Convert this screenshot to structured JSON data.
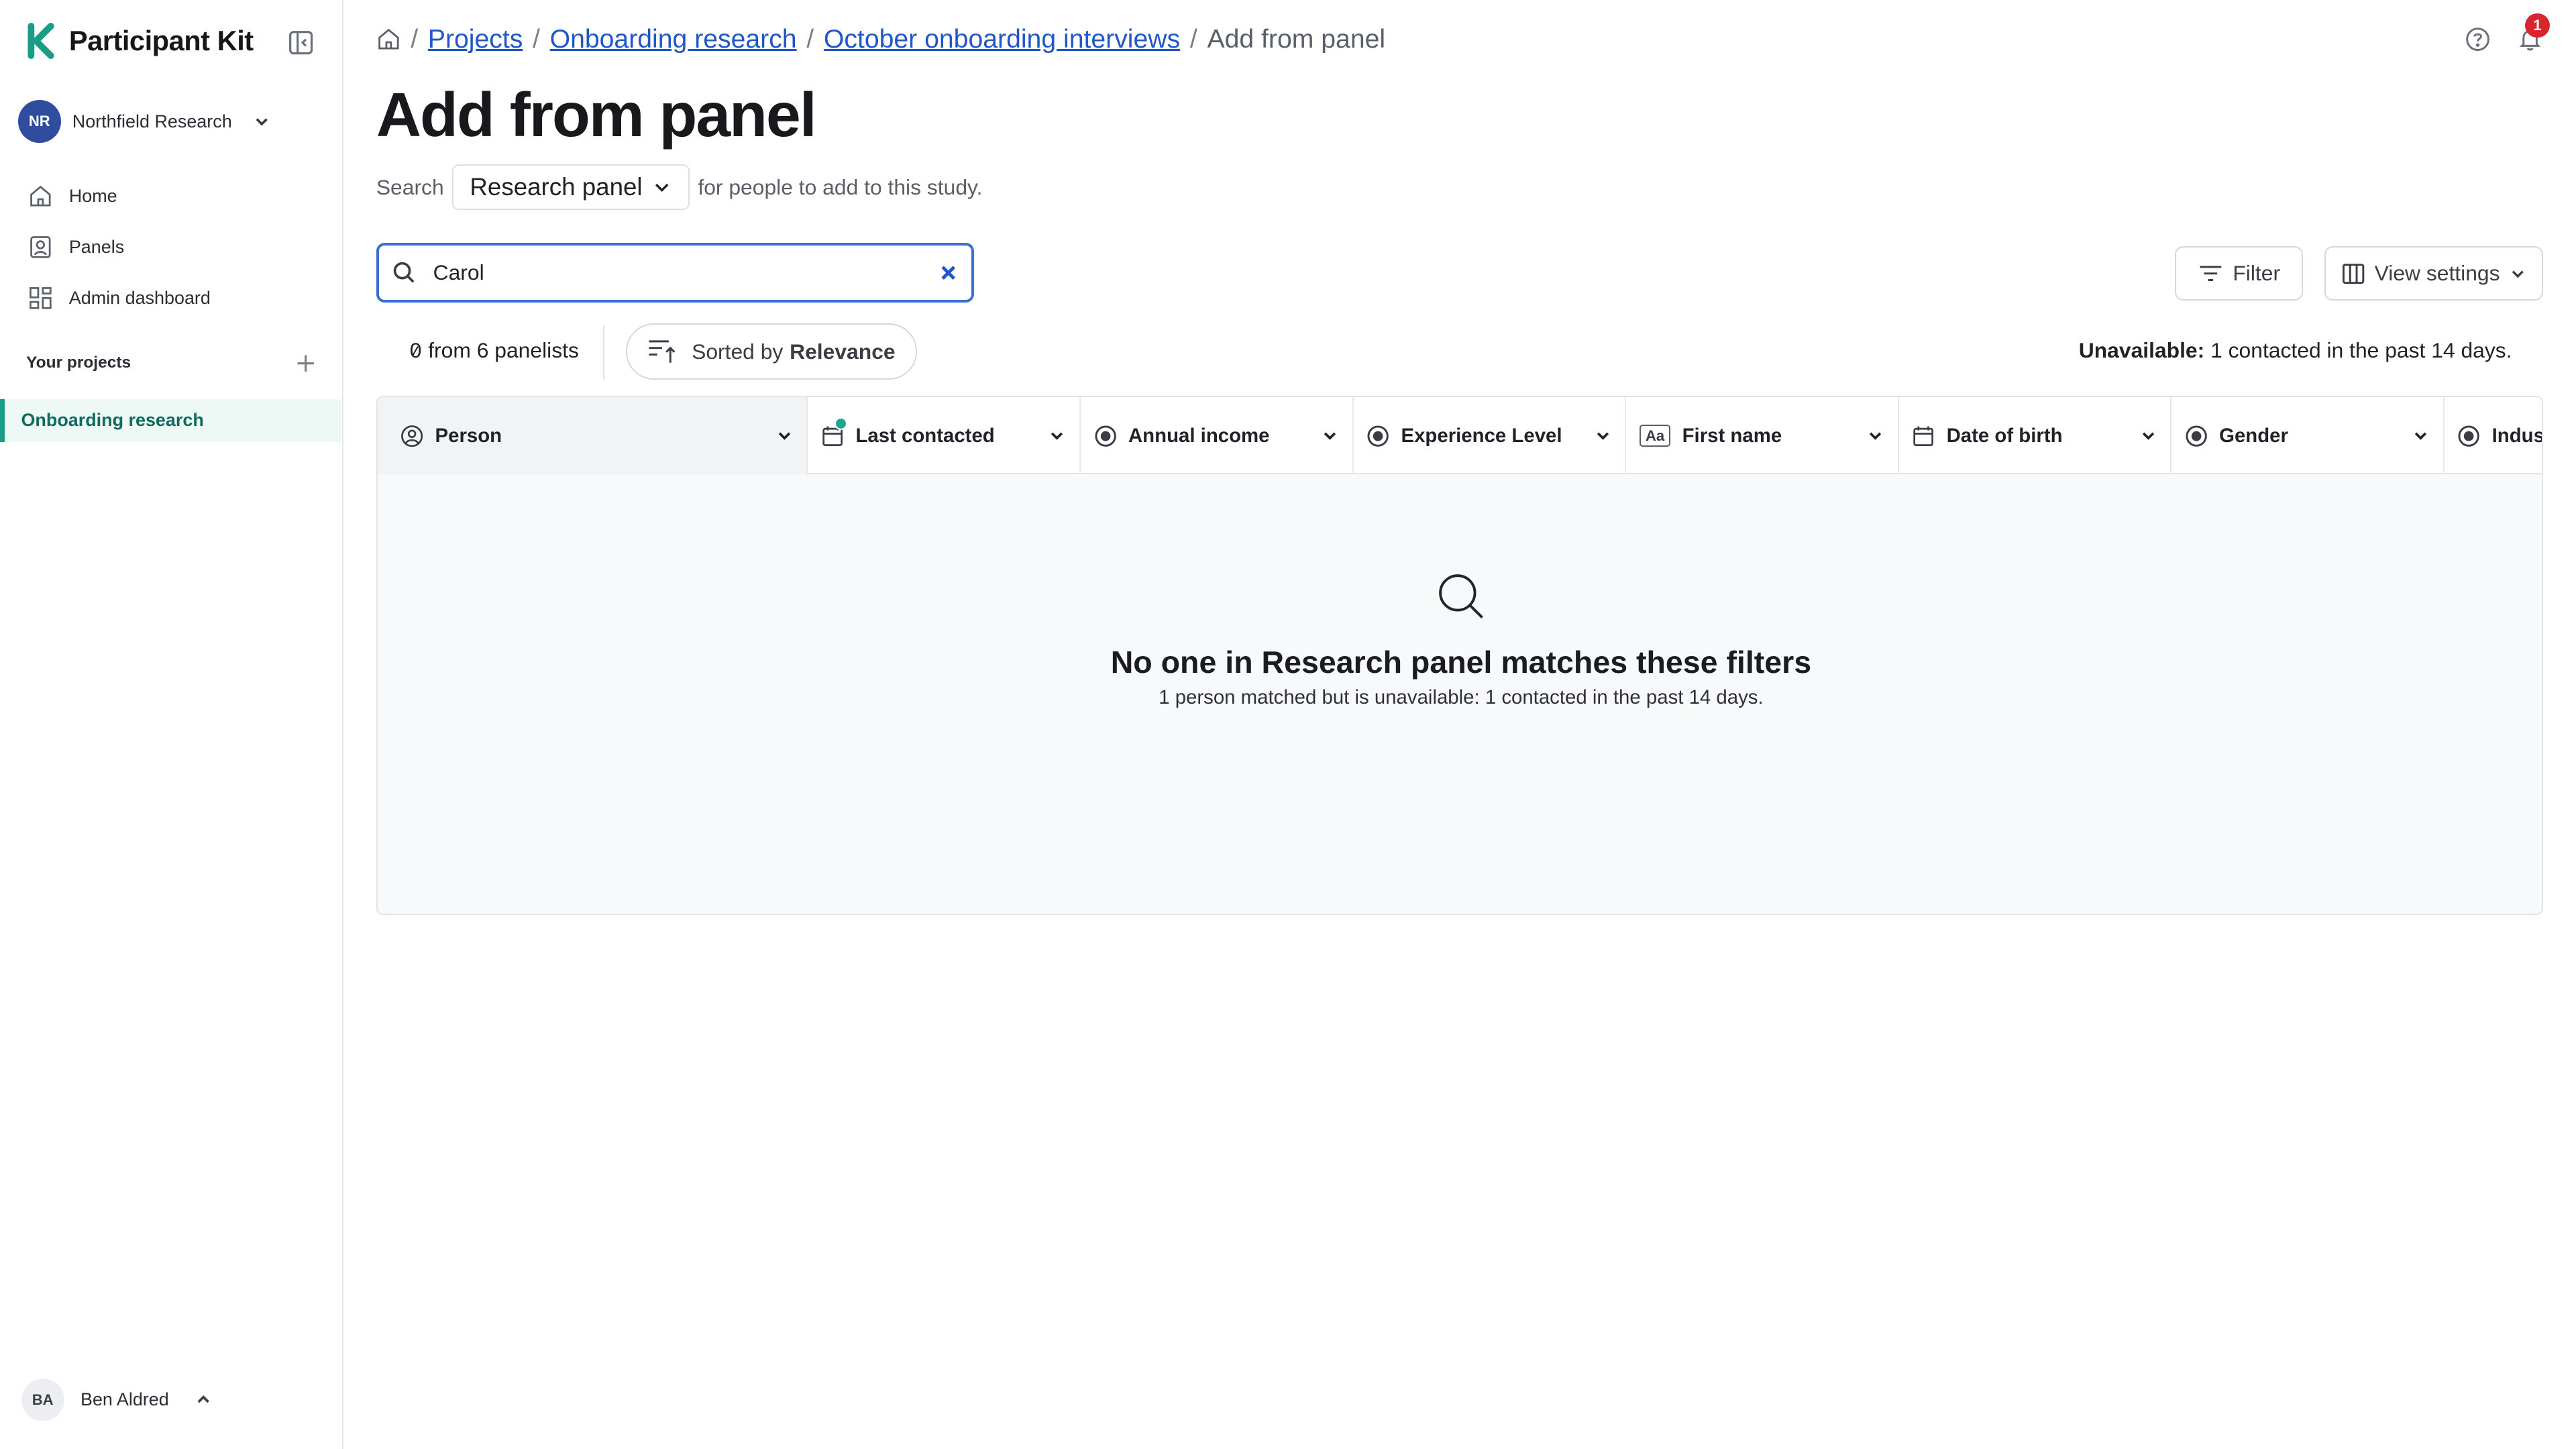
{
  "app": {
    "name": "Participant Kit",
    "brand_color": "#1a9d87",
    "link_color": "#2156c9"
  },
  "org": {
    "initials": "NR",
    "name": "Northfield Research"
  },
  "sidebar": {
    "nav": [
      {
        "label": "Home",
        "icon": "home-icon"
      },
      {
        "label": "Panels",
        "icon": "person-icon"
      },
      {
        "label": "Admin dashboard",
        "icon": "dashboard-icon"
      }
    ],
    "projects_label": "Your projects",
    "active_project": "Onboarding research"
  },
  "user": {
    "initials": "BA",
    "name": "Ben Aldred"
  },
  "breadcrumb": {
    "links": [
      "Projects",
      "Onboarding research",
      "October onboarding interviews"
    ],
    "current": "Add from panel"
  },
  "notifications": {
    "count": "1"
  },
  "page": {
    "title": "Add from panel",
    "search_prefix": "Search",
    "panel_selected": "Research panel",
    "search_suffix": "for people to add to this study."
  },
  "search": {
    "value": "Carol"
  },
  "toolbar": {
    "filter_label": "Filter",
    "view_settings_label": "View settings"
  },
  "results": {
    "count": "0",
    "count_suffix": "from 6 panelists",
    "sort_prefix": "Sorted by",
    "sort_value": "Relevance",
    "unavailable_label": "Unavailable:",
    "unavailable_text": "1 contacted in the past 14 days."
  },
  "table": {
    "columns": [
      {
        "label": "Person",
        "icon": "person-circle-icon"
      },
      {
        "label": "Last contacted",
        "icon": "calendar-icon"
      },
      {
        "label": "Annual income",
        "icon": "radio-icon"
      },
      {
        "label": "Experience Level",
        "icon": "radio-icon"
      },
      {
        "label": "First name",
        "icon": "text-icon",
        "icon_text": "Aa"
      },
      {
        "label": "Date of birth",
        "icon": "calendar-icon"
      },
      {
        "label": "Gender",
        "icon": "radio-icon"
      },
      {
        "label": "Indust",
        "icon": "radio-icon"
      }
    ]
  },
  "empty_state": {
    "title": "No one in Research panel matches these filters",
    "subtitle": "1 person matched but is unavailable: 1 contacted in the past 14 days."
  }
}
